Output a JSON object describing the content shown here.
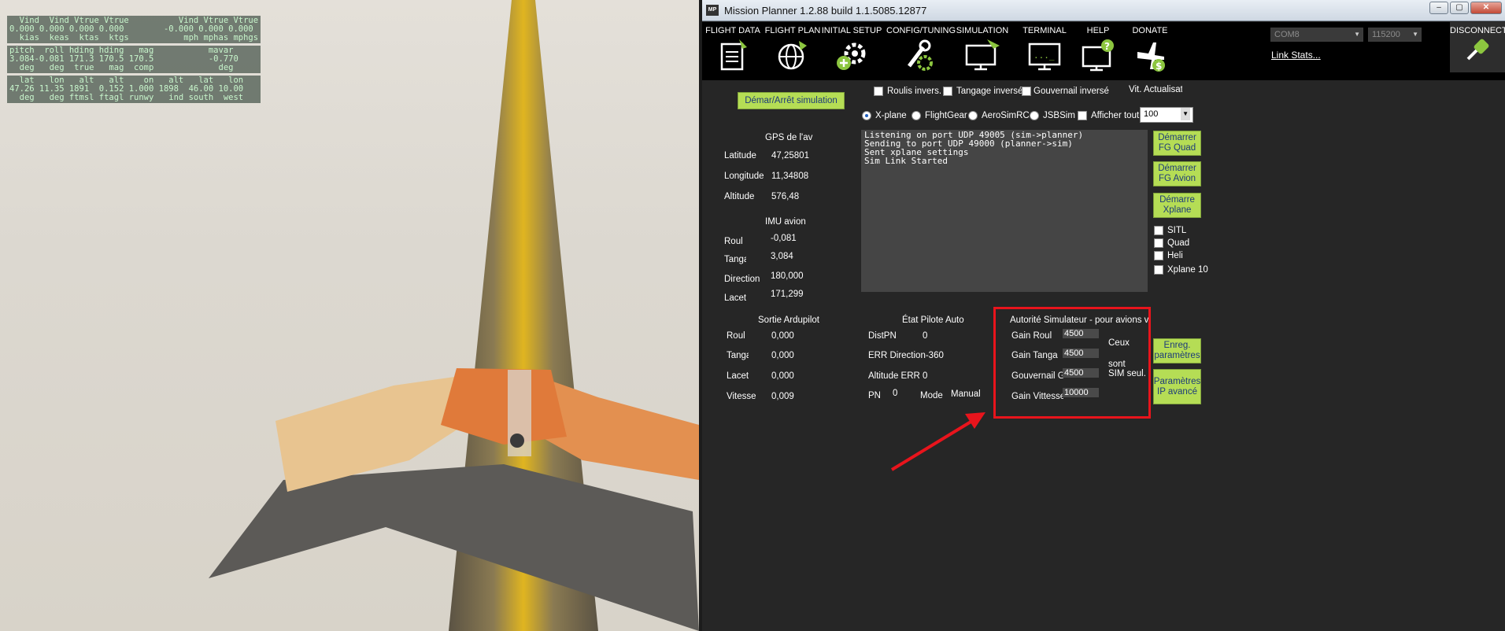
{
  "xplane_hud": {
    "block1": [
      "  Vind  Vind Vtrue Vtrue          Vind Vtrue Vtrue",
      "0.000 0.000 0.000 0.000        -0.000 0.000 0.000",
      "  kias  keas  ktas  ktgs           mph mphas mphgs"
    ],
    "block2": [
      "pitch  roll hding hding   mag           mavar",
      "3.084-0.081 171.3 170.5 170.5           -0.770",
      "  deg   deg  true   mag  comp             deg"
    ],
    "block3": [
      "  lat   lon   alt   alt    on   alt   lat   lon",
      "47.26 11.35 1891  0.152 1.000 1898  46.00 10.00",
      "  deg   deg ftmsl ftagl runwy   ind south  west"
    ]
  },
  "window": {
    "title": "Mission Planner 1.2.88 build 1.1.5085.12877",
    "app_icon": "MP"
  },
  "menu": {
    "items": [
      {
        "label": "FLIGHT DATA",
        "icon": "clipboard-icon"
      },
      {
        "label": "FLIGHT PLAN",
        "icon": "globe-icon"
      },
      {
        "label": "INITIAL SETUP",
        "icon": "gear-plus-icon"
      },
      {
        "label": "CONFIG/TUNING",
        "icon": "wrench-gear-icon"
      },
      {
        "label": "SIMULATION",
        "icon": "monitor-plane-icon"
      },
      {
        "label": "TERMINAL",
        "icon": "terminal-monitor-icon"
      },
      {
        "label": "HELP",
        "icon": "help-monitor-icon"
      },
      {
        "label": "DONATE",
        "icon": "plane-dollar-icon"
      }
    ],
    "com_port": "COM8",
    "baud": "115200",
    "link_stats": "Link Stats...",
    "disconnect": "DISCONNECT"
  },
  "sim": {
    "start_stop": "Démar/Arrêt simulation",
    "roll_inv": "Roulis invers.",
    "pitch_inv": "Tangage inversé",
    "rudder_inv": "Gouvernail inversé",
    "refresh_label": "Vit. Actualisation G",
    "sims": [
      "X-plane",
      "FlightGear",
      "AeroSimRC",
      "JSBSim"
    ],
    "show_all": "Afficher tout",
    "refresh_value": "100",
    "console": [
      "Listening on port UDP 49005 (sim->planner)",
      "Sending to port UDP 49000 (planner->sim)",
      "Sent xplane settings",
      "Sim Link Started"
    ],
    "btn_fg_quad": [
      "Démarrer",
      "FG Quad"
    ],
    "btn_fg_plane": [
      "Démarrer",
      "FG Avion"
    ],
    "btn_xplane": [
      "Démarre",
      "Xplane"
    ],
    "opt_sitl": "SITL",
    "opt_quad": "Quad",
    "opt_heli": "Heli",
    "opt_xplane10": "Xplane 10",
    "gps_title": "GPS de l'av",
    "gps": [
      {
        "label": "Latitude",
        "value": "47,25801"
      },
      {
        "label": "Longitude",
        "value": "11,34808"
      },
      {
        "label": "Altitude",
        "value": "576,48"
      }
    ],
    "imu_title": "IMU avion",
    "imu": [
      {
        "label": "Roul",
        "value": "-0,081"
      },
      {
        "label": "Tanga",
        "value": "3,084"
      },
      {
        "label": "Direction",
        "value": "180,000"
      },
      {
        "label": "Lacet",
        "value": "171,299"
      }
    ],
    "output_title": "Sortie Ardupilot",
    "output": [
      {
        "label": "Roul",
        "value": "0,000"
      },
      {
        "label": "Tanga",
        "value": "0,000"
      },
      {
        "label": "Lacet",
        "value": "0,000"
      },
      {
        "label": "Vitesse",
        "value": "0,009"
      }
    ],
    "autopilot_title": "État Pilote Auto",
    "dist_label": "DistPN",
    "dist_value": "0",
    "err_dir": "ERR Direction-360",
    "alt_err_label": "Altitude ERR",
    "alt_err_value": "0",
    "pn_label": "PN",
    "pn_value": "0",
    "mode_label": "Mode",
    "mode_value": "Manual",
    "authority_title": "Autorité Simulateur - pour avions v",
    "gains": [
      {
        "label": "Gain Roul",
        "value": "4500"
      },
      {
        "label": "Gain Tanga",
        "value": "4500"
      },
      {
        "label": "Gouvernail G",
        "value": "4500"
      },
      {
        "label": "Gain Vittesse",
        "value": "10000"
      }
    ],
    "note1": "Ceux",
    "note2": "sont",
    "note3": "SIM seul.",
    "btn_save": [
      "Enreg.",
      "paramètres"
    ],
    "btn_advanced": [
      "Paramètres",
      "IP avancé"
    ]
  }
}
